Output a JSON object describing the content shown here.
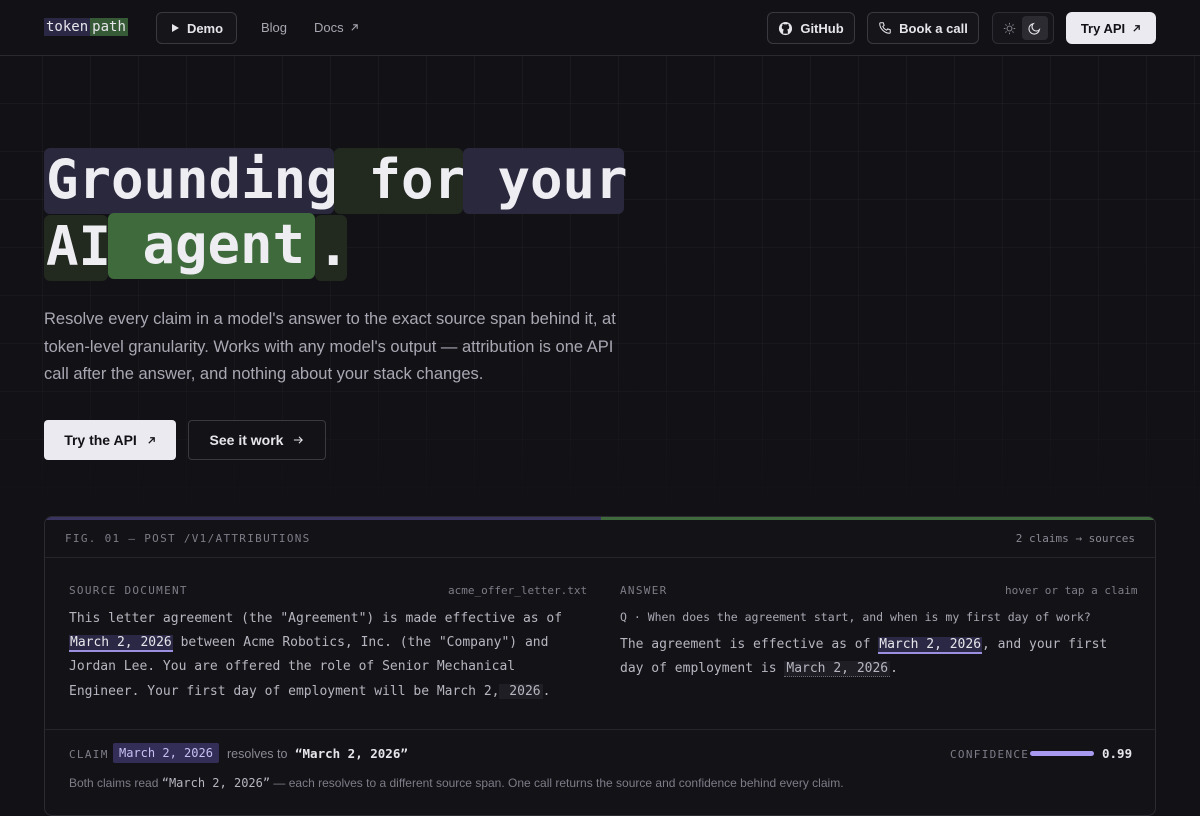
{
  "nav": {
    "logo_part1": "token",
    "logo_part2": "path",
    "demo_label": "Demo",
    "blog_label": "Blog",
    "docs_label": "Docs",
    "github_label": "GitHub",
    "book_label": "Book a call",
    "try_api_label": "Try API"
  },
  "hero": {
    "tokens": [
      "Grounding",
      " for",
      " your",
      "AI",
      " agent",
      "."
    ],
    "subtitle": "Resolve every claim in a model's answer to the exact source span behind it, at token-level granularity. Works with any model's output — attribution is one API call after the answer, and nothing about your stack changes.",
    "cta_primary": "Try the API",
    "cta_secondary": "See it work"
  },
  "figure": {
    "title": "FIG. 01 — POST /V1/ATTRIBUTIONS",
    "meta": "2 claims → sources",
    "source_label": "SOURCE DOCUMENT",
    "source_file": "acme_offer_letter.txt",
    "source_text": {
      "p1": "This letter agreement (the \"Agreement\") is made effective as of",
      "date1": "March 2, 2026",
      "p2": " between Acme Robotics, Inc. (the \"Company\") and Jordan Lee. You are offered the role of Senior Mechanical Engineer. Your first day of employment will be March 2,",
      "date2_tail": " 2026",
      "p3": "."
    },
    "answer_label": "ANSWER",
    "answer_hint": "hover or tap a claim",
    "question": "Q · When does the agreement start, and when is my first day of work?",
    "answer_text": {
      "p1": "The agreement is effective as of ",
      "date1": "March 2, 2026",
      "p2": ", and your first day of employment is ",
      "date2": "March 2, 2026",
      "p3": "."
    },
    "claim_label": "CLAIM",
    "claim_value": "March 2, 2026",
    "resolves_to": "resolves to",
    "resolved_value": "“March 2, 2026”",
    "confidence_label": "CONFIDENCE",
    "confidence_value": "0.99",
    "footnote_pre": "Both claims read ",
    "footnote_quote": "“March 2, 2026”",
    "footnote_post": " — each resolves to a different source span. One call returns the source and confidence behind every claim."
  },
  "colors": {
    "background": "#121116",
    "accent_purple": "#9b8fe0",
    "accent_green": "#3f6a3c"
  }
}
